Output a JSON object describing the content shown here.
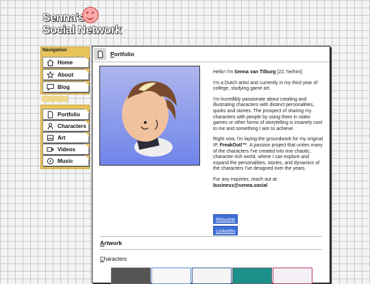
{
  "logo": {
    "line1": "Senna's",
    "line2": "Social Network"
  },
  "nav": {
    "heading": "Navigation",
    "items": [
      {
        "label": "Home",
        "icon": "home-icon"
      },
      {
        "label": "About",
        "icon": "star-icon"
      },
      {
        "label": "Blog",
        "icon": "chat-icon"
      }
    ],
    "items2": [
      {
        "label": "Portfolio",
        "icon": "document-icon"
      },
      {
        "label": "Characters",
        "icon": "person-icon"
      },
      {
        "label": "Art",
        "icon": "image-icon"
      },
      {
        "label": "Videos",
        "icon": "video-icon"
      },
      {
        "label": "Music",
        "icon": "disc-icon"
      }
    ]
  },
  "panel": {
    "title_first": "P",
    "title_rest": "ortfolio",
    "bio": {
      "greeting_pre": "Hello! I'm ",
      "name": "Senna van Tilburg",
      "greeting_post": " [22, he/him]",
      "p2": "I'm a Dutch artist and currently in my third year of college, studying game art.",
      "p3": "I'm incredibly passionate about creating and illustrating characters with distinct personalities, quirks and stories. The prospect of sharing my characters with people by using them in video games or other forms of storytelling is insanely cool to me and something I aim to achieve.",
      "p4_pre": "Right now, I'm laying the groundwork for my original IP, ",
      "p4_ip": "FreakOut!™",
      "p4_post": ". A passion project that unites many of the characters I've created into one chaotic, character-rich world, where I can explore and expand the personalities, stories, and dynamics of the characters I've designed over the years.",
      "p5": "For any inquiries, reach out at:",
      "email": "business@senna.social"
    },
    "links": {
      "resume": "Resume",
      "linkedin": "LinkedIn"
    },
    "artwork_first": "A",
    "artwork_rest": "rtwork",
    "characters_first": "C",
    "characters_rest": "haracters"
  },
  "colors": {
    "nav_bg": "#e9c45a",
    "link_bg": "#3f6fd8",
    "portrait_top": "#aeb6ec",
    "portrait_bottom": "#6f84ea"
  }
}
